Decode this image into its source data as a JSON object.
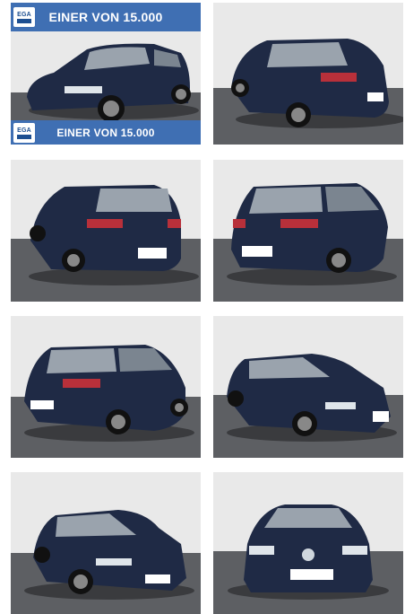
{
  "gallery": {
    "banner_text": "EINER VON 15.000",
    "logo_text": "EGA",
    "brand_color": "#3f6fb3",
    "car_color": "#1f2a45",
    "photos": [
      {
        "view": "front-left"
      },
      {
        "view": "rear-right"
      },
      {
        "view": "rear-left"
      },
      {
        "view": "rear-right"
      },
      {
        "view": "rear-left"
      },
      {
        "view": "front-right"
      },
      {
        "view": "front-left"
      },
      {
        "view": "front"
      }
    ]
  }
}
